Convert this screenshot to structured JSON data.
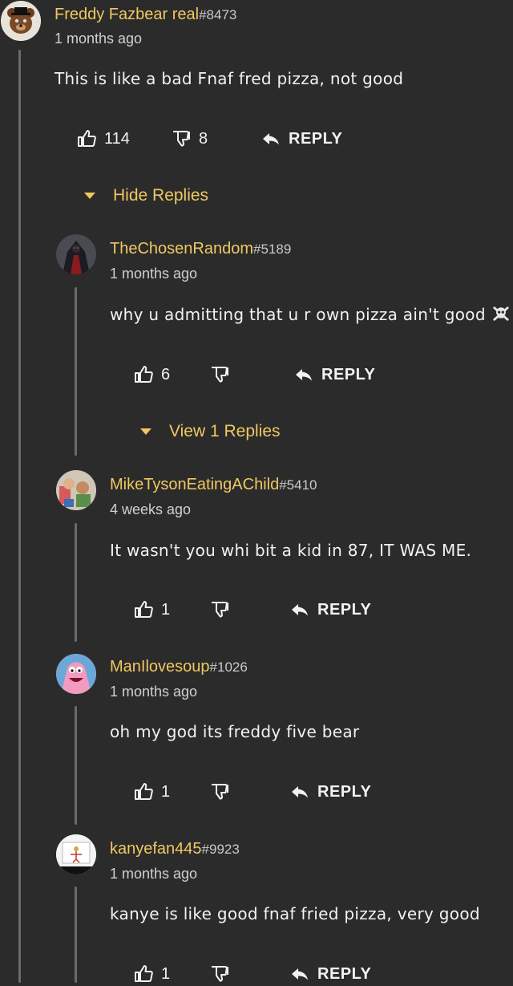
{
  "colors": {
    "background": "#2b2b2b",
    "username": "#f0c860",
    "text": "#f2f2f2",
    "thread_line": "#6b6b6b"
  },
  "comment": {
    "username": "Freddy Fazbear real",
    "tag": "#8473",
    "time": "1 months ago",
    "text": "This is like a bad Fnaf fred pizza, not good",
    "likes": "114",
    "dislikes": "8",
    "reply_label": "REPLY",
    "replies_toggle": "Hide Replies"
  },
  "replies": [
    {
      "username": "TheChosenRandom",
      "tag": "#5189",
      "time": "1 months ago",
      "text": "why u admitting that u r own pizza ain't good",
      "emoji": "skull-crossbones-icon",
      "likes": "6",
      "dislikes": "",
      "reply_label": "REPLY",
      "replies_toggle": "View 1 Replies"
    },
    {
      "username": "MikeTysonEatingAChild",
      "tag": "#5410",
      "time": "4 weeks ago",
      "text": "It wasn't you whi bit a kid in 87, IT WAS ME.",
      "likes": "1",
      "dislikes": "",
      "reply_label": "REPLY"
    },
    {
      "username": "ManIlovesoup",
      "tag": "#1026",
      "time": "1 months ago",
      "text": "oh my god its freddy five bear",
      "likes": "1",
      "dislikes": "",
      "reply_label": "REPLY"
    },
    {
      "username": "kanyefan445",
      "tag": "#9923",
      "time": "1 months ago",
      "text": "kanye is like good fnaf fried pizza, very good",
      "likes": "1",
      "dislikes": "",
      "reply_label": "REPLY"
    }
  ]
}
